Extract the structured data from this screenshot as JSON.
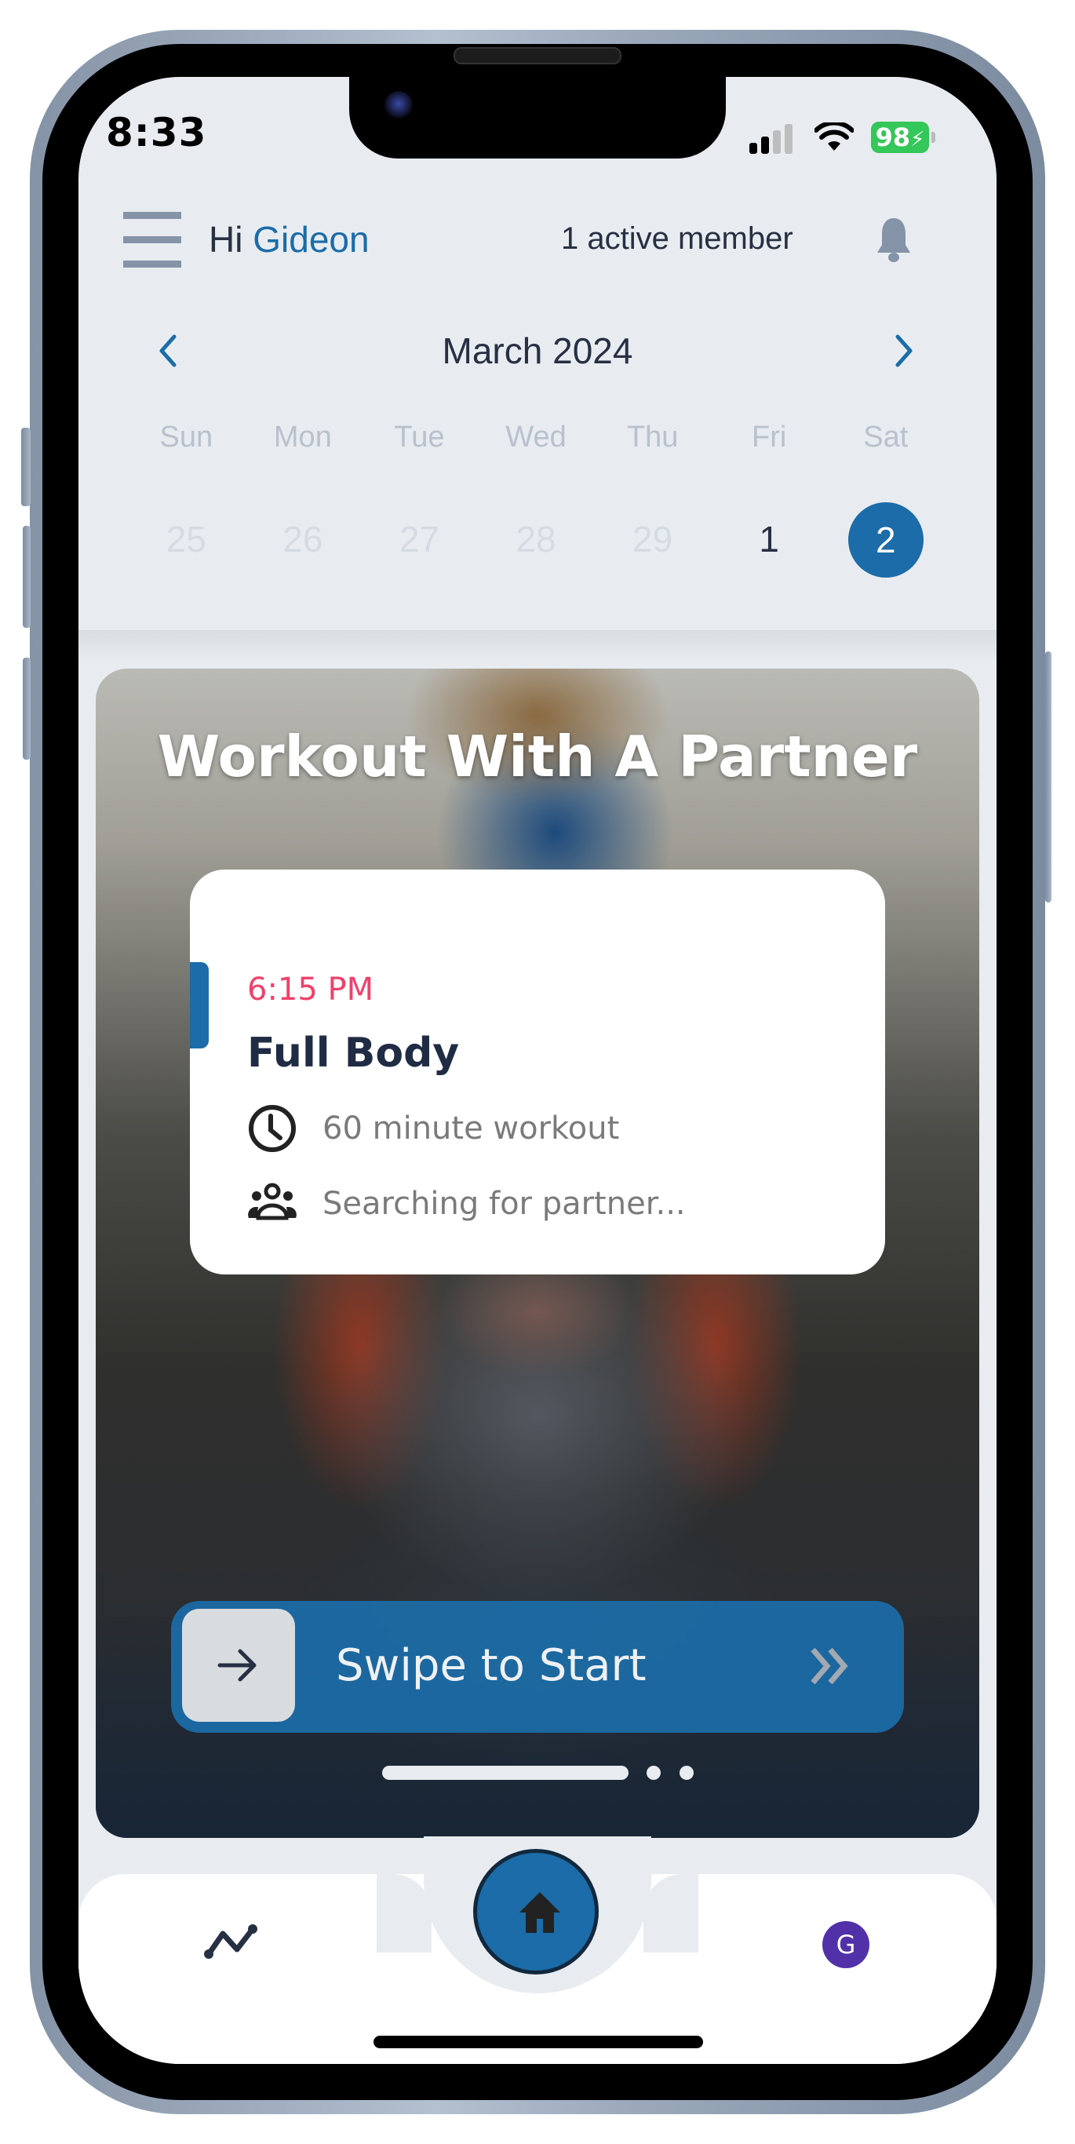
{
  "status_bar": {
    "time": "8:33",
    "battery": "98",
    "signal_bars_active": 2,
    "signal_bars_total": 4
  },
  "header": {
    "greeting_prefix": "Hi",
    "user_name": "Gideon",
    "active_members": "1 active member",
    "icons": {
      "menu": "hamburger-menu-icon",
      "notifications": "bell-icon"
    }
  },
  "calendar": {
    "month_label": "March 2024",
    "prev_icon": "chevron-left-icon",
    "next_icon": "chevron-right-icon",
    "weekdays": [
      "Sun",
      "Mon",
      "Tue",
      "Wed",
      "Thu",
      "Fri",
      "Sat"
    ],
    "days": [
      {
        "label": "25",
        "state": "outside"
      },
      {
        "label": "26",
        "state": "outside"
      },
      {
        "label": "27",
        "state": "outside"
      },
      {
        "label": "28",
        "state": "outside"
      },
      {
        "label": "29",
        "state": "outside"
      },
      {
        "label": "1",
        "state": "current"
      },
      {
        "label": "2",
        "state": "selected"
      }
    ]
  },
  "hero": {
    "title": "Workout With A Partner",
    "workout": {
      "time": "6:15 PM",
      "name": "Full Body",
      "duration": "60 minute workout",
      "partner_status": "Searching for partner..."
    },
    "swipe_label": "Swipe to Start",
    "pager": {
      "count": 3,
      "active_index": 0
    }
  },
  "bottom_nav": {
    "items": [
      {
        "name": "stats",
        "icon": "trend-line-icon"
      },
      {
        "name": "home",
        "icon": "home-icon",
        "active": true
      },
      {
        "name": "profile",
        "avatar_initial": "G"
      }
    ]
  },
  "colors": {
    "accent": "#1b6ca8",
    "time_highlight": "#f0416a",
    "avatar": "#5130a8",
    "background": "#e8ecf0",
    "battery": "#34c759"
  }
}
